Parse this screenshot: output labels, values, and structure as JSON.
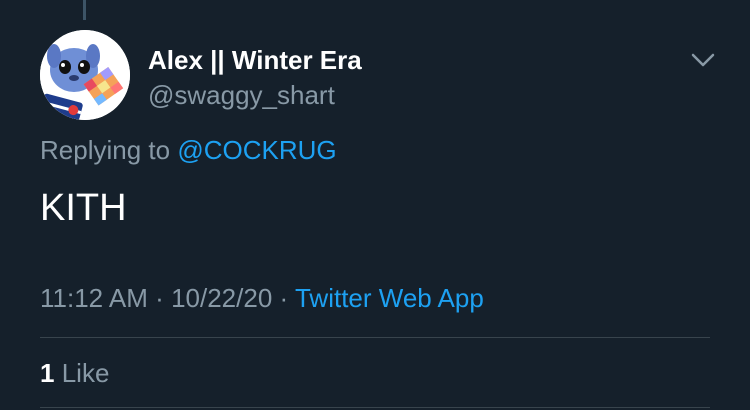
{
  "tweet": {
    "author": {
      "display_name": "Alex || Winter Era",
      "handle": "@swaggy_shart",
      "avatar_icon": "stitch-avatar-icon"
    },
    "reply": {
      "prefix": "Replying to",
      "mention": "@COCKRUG"
    },
    "text": "KITH",
    "meta": {
      "time": "11:12 AM",
      "separator_1": "·",
      "date": "10/22/20",
      "separator_2": "·",
      "source": "Twitter Web App"
    },
    "engagement": {
      "like_count": "1",
      "like_label": "Like"
    },
    "menu_icon": "chevron-down-icon"
  },
  "colors": {
    "background": "#15202b",
    "primary_text": "#ffffff",
    "secondary_text": "#8899a6",
    "accent": "#1da1f2",
    "divider": "#38444d"
  }
}
